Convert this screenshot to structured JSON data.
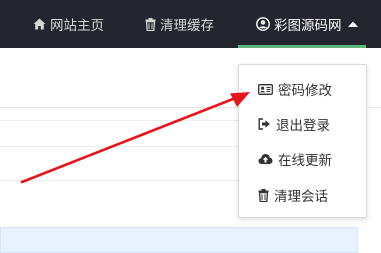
{
  "topbar": {
    "items": [
      {
        "label": "网站主页",
        "icon": "home-icon"
      },
      {
        "label": "清理缓存",
        "icon": "trash-icon"
      },
      {
        "label": "彩图源码网",
        "icon": "user-circle-icon"
      }
    ],
    "active_color": "#5fb878",
    "background": "#23262e"
  },
  "dropdown": {
    "items": [
      {
        "label": "密码修改",
        "icon": "id-card-icon"
      },
      {
        "label": "退出登录",
        "icon": "sign-out-icon"
      },
      {
        "label": "在线更新",
        "icon": "cloud-upload-icon"
      },
      {
        "label": "清理会话",
        "icon": "trash-icon"
      }
    ]
  },
  "annotation": {
    "color": "#e8141b",
    "icon": "arrow-annotation"
  }
}
